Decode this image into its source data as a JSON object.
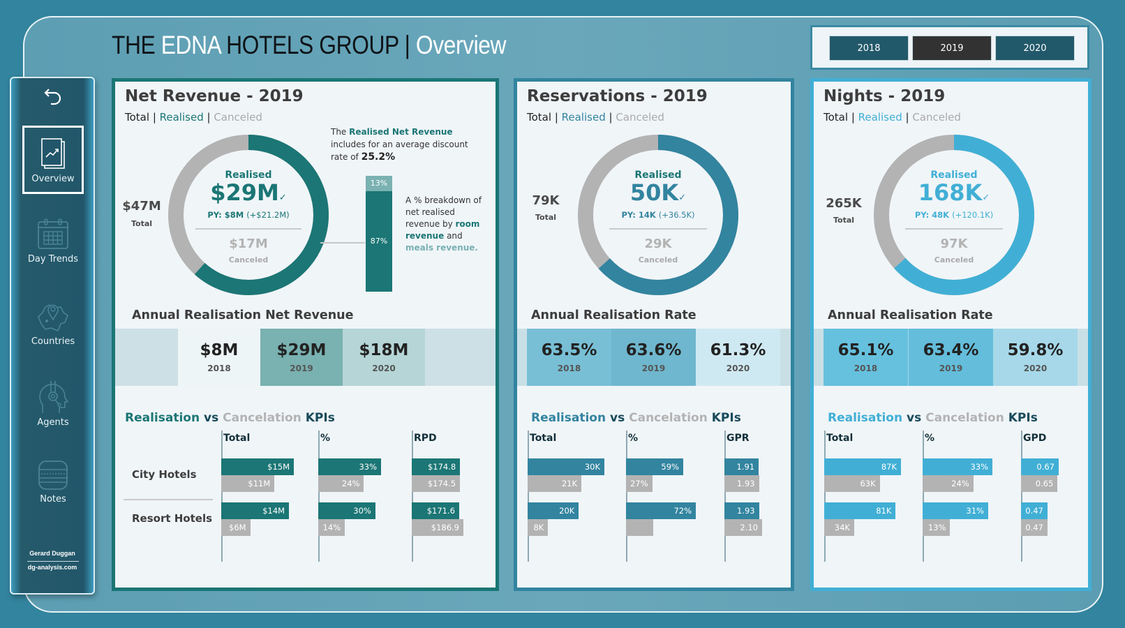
{
  "header": {
    "title_part1": "THE ",
    "title_brand": "EDNA",
    "title_part2": " HOTELS GROUP | ",
    "title_page": "Overview"
  },
  "year_filter": {
    "options": [
      "2018",
      "2019",
      "2020"
    ],
    "selected": "2019"
  },
  "sidebar": {
    "back_label": "back",
    "items": [
      {
        "label": "Overview",
        "icon": "chart-report-icon",
        "selected": true
      },
      {
        "label": "Day Trends",
        "icon": "calendar-icon"
      },
      {
        "label": "Countries",
        "icon": "map-pin-icon"
      },
      {
        "label": "Agents",
        "icon": "headset-agent-icon"
      },
      {
        "label": "Notes",
        "icon": "notes-icon"
      }
    ],
    "author": "Gerard Duggan",
    "site": "dg-analysis.com"
  },
  "legend": {
    "total": "Total",
    "realised": "Realised",
    "canceled": "Canceled",
    "sep": " | "
  },
  "colors": {
    "revenue": "#1b7675",
    "reservations": "#32849f",
    "nights": "#41afd5",
    "canceled": "#b3b3b3"
  },
  "cards": [
    {
      "id": "revenue",
      "title": "Net Revenue - 2019",
      "donut": {
        "realised_label": "Realised",
        "realised": "$29M",
        "realised_share": 0.617,
        "py": "PY: $8M",
        "py_delta": "(+$21.2M)",
        "canceled": "$17M",
        "canceled_label": "Canceled",
        "total": "$47M",
        "total_label": "Total"
      },
      "note": {
        "pre": "The ",
        "strong": "Realised Net Revenue",
        "post": " includes for an average discount rate of ",
        "rate": "25.2%"
      },
      "breakdown": {
        "room_pct": 87,
        "meals_pct": 13,
        "room_label": "87%",
        "meals_label": "13%"
      },
      "breakdown_note": {
        "pre": "A % breakdown of net realised revenue by ",
        "room": "room revenue",
        "and": " and ",
        "meals": "meals revenue."
      },
      "annual_title": "Annual Realisation Net Revenue",
      "annual": [
        {
          "value": "$8M",
          "year": "2018"
        },
        {
          "value": "$29M",
          "year": "2019"
        },
        {
          "value": "$18M",
          "year": "2020"
        }
      ],
      "kpi_title": {
        "a": "Realisation",
        "vs": " vs ",
        "b": "Cancelation",
        "c": " KPIs"
      },
      "kpi_cols": [
        "Total",
        "%",
        "RPD"
      ],
      "kpi_rows": [
        {
          "label": "City Hotels",
          "values": [
            {
              "r": "$15M",
              "c": "$11M",
              "rv": 15,
              "cv": 11
            },
            {
              "r": "33%",
              "c": "24%",
              "rv": 33,
              "cv": 24
            },
            {
              "r": "$174.8",
              "c": "$174.5",
              "rv": 174.8,
              "cv": 174.5
            }
          ]
        },
        {
          "label": "Resort Hotels",
          "values": [
            {
              "r": "$14M",
              "c": "$6M",
              "rv": 14,
              "cv": 6
            },
            {
              "r": "30%",
              "c": "14%",
              "rv": 30,
              "cv": 14
            },
            {
              "r": "$171.6",
              "c": "$186.9",
              "rv": 171.6,
              "cv": 186.9
            }
          ]
        }
      ]
    },
    {
      "id": "reservations",
      "title": "Reservations - 2019",
      "donut": {
        "realised_label": "Realised",
        "realised": "50K",
        "realised_share": 0.633,
        "py": "PY: 14K",
        "py_delta": "(+36.5K)",
        "canceled": "29K",
        "canceled_label": "Canceled",
        "total": "79K",
        "total_label": "Total"
      },
      "annual_title": "Annual Realisation Rate",
      "annual": [
        {
          "value": "63.5%",
          "year": "2018"
        },
        {
          "value": "63.6%",
          "year": "2019"
        },
        {
          "value": "61.3%",
          "year": "2020"
        }
      ],
      "kpi_title": {
        "a": "Realisation",
        "vs": " vs ",
        "b": "Cancelation",
        "c": " KPIs"
      },
      "kpi_cols": [
        "Total",
        "%",
        "GPR"
      ],
      "kpi_rows": [
        {
          "label": "City Hotels",
          "values": [
            {
              "r": "30K",
              "c": "21K",
              "rv": 30,
              "cv": 21
            },
            {
              "r": "59%",
              "c": "27%",
              "rv": 59,
              "cv": 27
            },
            {
              "r": "1.91",
              "c": "1.93",
              "rv": 1.91,
              "cv": 1.93
            }
          ]
        },
        {
          "label": "Resort Hotels",
          "values": [
            {
              "r": "20K",
              "c": "8K",
              "rv": 20,
              "cv": 8
            },
            {
              "r": "72%",
              "c": "",
              "rv": 72,
              "cv": 28
            },
            {
              "r": "1.93",
              "c": "2.10",
              "rv": 1.93,
              "cv": 2.1
            }
          ]
        }
      ]
    },
    {
      "id": "nights",
      "title": "Nights - 2019",
      "donut": {
        "realised_label": "Realised",
        "realised": "168K",
        "realised_share": 0.634,
        "py": "PY: 48K",
        "py_delta": "(+120.1K)",
        "canceled": "97K",
        "canceled_label": "Canceled",
        "total": "265K",
        "total_label": "Total"
      },
      "annual_title": "Annual Realisation Rate",
      "annual": [
        {
          "value": "65.1%",
          "year": "2018"
        },
        {
          "value": "63.4%",
          "year": "2019"
        },
        {
          "value": "59.8%",
          "year": "2020"
        }
      ],
      "kpi_title": {
        "a": "Realisation",
        "vs": " vs ",
        "b": "Cancelation",
        "c": " KPIs"
      },
      "kpi_cols": [
        "Total",
        "%",
        "GPD"
      ],
      "kpi_rows": [
        {
          "label": "City Hotels",
          "values": [
            {
              "r": "87K",
              "c": "63K",
              "rv": 87,
              "cv": 63
            },
            {
              "r": "33%",
              "c": "24%",
              "rv": 33,
              "cv": 24
            },
            {
              "r": "0.67",
              "c": "0.65",
              "rv": 0.67,
              "cv": 0.65
            }
          ]
        },
        {
          "label": "Resort Hotels",
          "values": [
            {
              "r": "81K",
              "c": "34K",
              "rv": 81,
              "cv": 34
            },
            {
              "r": "31%",
              "c": "13%",
              "rv": 31,
              "cv": 13
            },
            {
              "r": "0.47",
              "c": "0.47",
              "rv": 0.47,
              "cv": 0.47
            }
          ]
        }
      ]
    }
  ]
}
